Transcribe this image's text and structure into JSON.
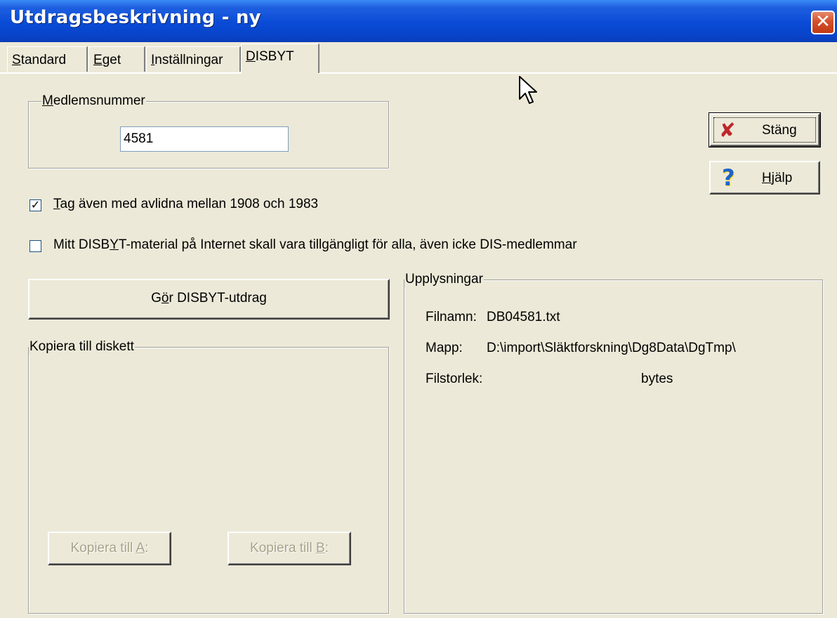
{
  "window": {
    "title": "Utdragsbeskrivning - ny",
    "close_glyph": "✕"
  },
  "tabs": [
    {
      "pre": "",
      "ul": "S",
      "post": "tandard",
      "active": false
    },
    {
      "pre": "",
      "ul": "E",
      "post": "get",
      "active": false
    },
    {
      "pre": "",
      "ul": "I",
      "post": "nställningar",
      "active": false
    },
    {
      "pre": "",
      "ul": "D",
      "post": "ISBYT",
      "active": true
    }
  ],
  "member": {
    "group_pre": "",
    "group_ul": "M",
    "group_post": "edlemsnummer",
    "value": "4581"
  },
  "checkbox_deceased": {
    "checked": true,
    "check_glyph": "✓",
    "pre": "",
    "ul": "T",
    "post": "ag även med avlidna mellan 1908 och 1983"
  },
  "checkbox_public": {
    "checked": false,
    "pre": "Mitt DISB",
    "ul": "Y",
    "post": "T-material på Internet skall vara tillgängligt för alla, även icke DIS-medlemmar"
  },
  "buttons": {
    "close": {
      "pre": "",
      "ul": "",
      "post": "Stäng",
      "icon": "close-x-icon",
      "icon_glyph": "✘",
      "color": "#C0262C"
    },
    "help": {
      "pre": "",
      "ul": "H",
      "post": "jälp",
      "icon": "question-icon",
      "icon_glyph": "?",
      "color": "#1E64C8"
    },
    "make_extract": {
      "pre": "G",
      "ul": "ö",
      "post": "r DISBYT-utdrag"
    },
    "copy_a": {
      "pre": "Kopiera till ",
      "ul": "A",
      "post": ":"
    },
    "copy_b": {
      "pre": "Kopiera till ",
      "ul": "B",
      "post": ":"
    }
  },
  "copy_group": {
    "label": "Kopiera till diskett"
  },
  "info": {
    "label": "Upplysningar",
    "rows": [
      {
        "key": "Filnamn:",
        "value": "DB04581.txt"
      },
      {
        "key": "Mapp:",
        "value": "D:\\import\\Släktforskning\\Dg8Data\\DgTmp\\"
      },
      {
        "key": "Filstorlek:",
        "value": "bytes"
      }
    ]
  }
}
